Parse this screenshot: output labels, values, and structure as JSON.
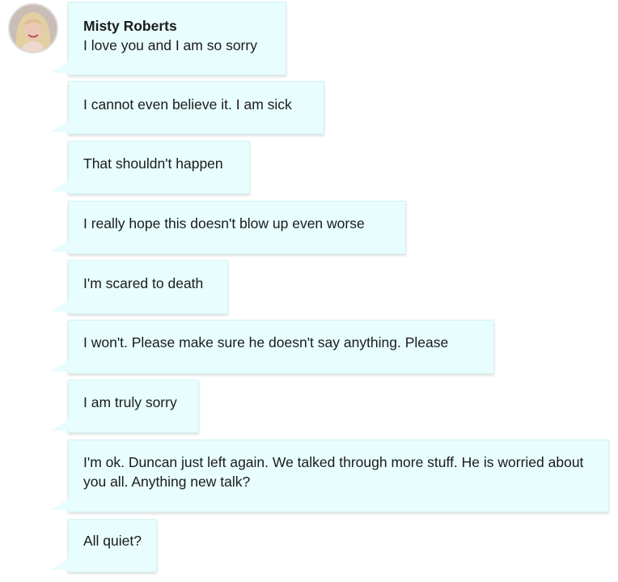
{
  "contact": {
    "name": "Misty Roberts",
    "avatar_icon": "profile-photo"
  },
  "colors": {
    "bubble_background": "#e8fdfd",
    "bubble_border": "#d2f3f3",
    "text": "#1b1b1b"
  },
  "messages": [
    {
      "sender": "Misty Roberts",
      "text": "I love you and I am so sorry"
    },
    {
      "text": "I cannot even believe it. I am sick"
    },
    {
      "text": "That shouldn't happen"
    },
    {
      "text": "I really hope this doesn't blow up even worse"
    },
    {
      "text": "I'm scared to death"
    },
    {
      "text": "I won't. Please make sure he doesn't say anything. Please"
    },
    {
      "text": "I am truly sorry"
    },
    {
      "text": "I'm ok. Duncan just left again. We talked through more stuff. He is worried about you all. Anything new talk?"
    },
    {
      "text": "All quiet?"
    }
  ]
}
